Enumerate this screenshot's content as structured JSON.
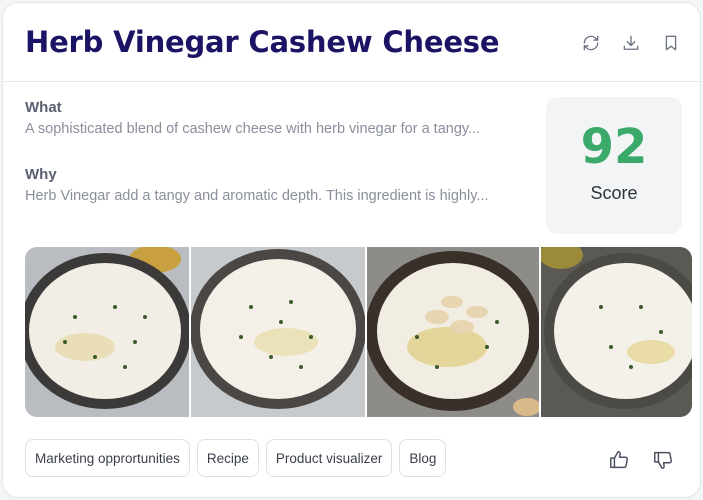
{
  "header": {
    "title": "Herb Vinegar Cashew Cheese",
    "actions": [
      "refresh-icon",
      "download-icon",
      "bookmark-icon"
    ]
  },
  "what": {
    "label": "What",
    "text": "A sophisticated blend of cashew cheese with herb vinegar for a tangy..."
  },
  "why": {
    "label": "Why",
    "text": "Herb Vinegar add a tangy and aromatic depth. This ingredient is highly..."
  },
  "score": {
    "value": "92",
    "label": "Score",
    "color": "#3aa96a"
  },
  "gallery": {
    "photos": [
      "cashew-cheese-bowl-1",
      "cashew-cheese-bowl-2",
      "cashew-cheese-bowl-3",
      "cashew-cheese-bowl-4"
    ]
  },
  "chips": [
    "Marketing opprortunities",
    "Recipe",
    "Product visualizer",
    "Blog"
  ],
  "feedback": [
    "thumbs-up-icon",
    "thumbs-down-icon"
  ],
  "colors": {
    "title": "#1b1464",
    "accent": "#3aa96a"
  }
}
